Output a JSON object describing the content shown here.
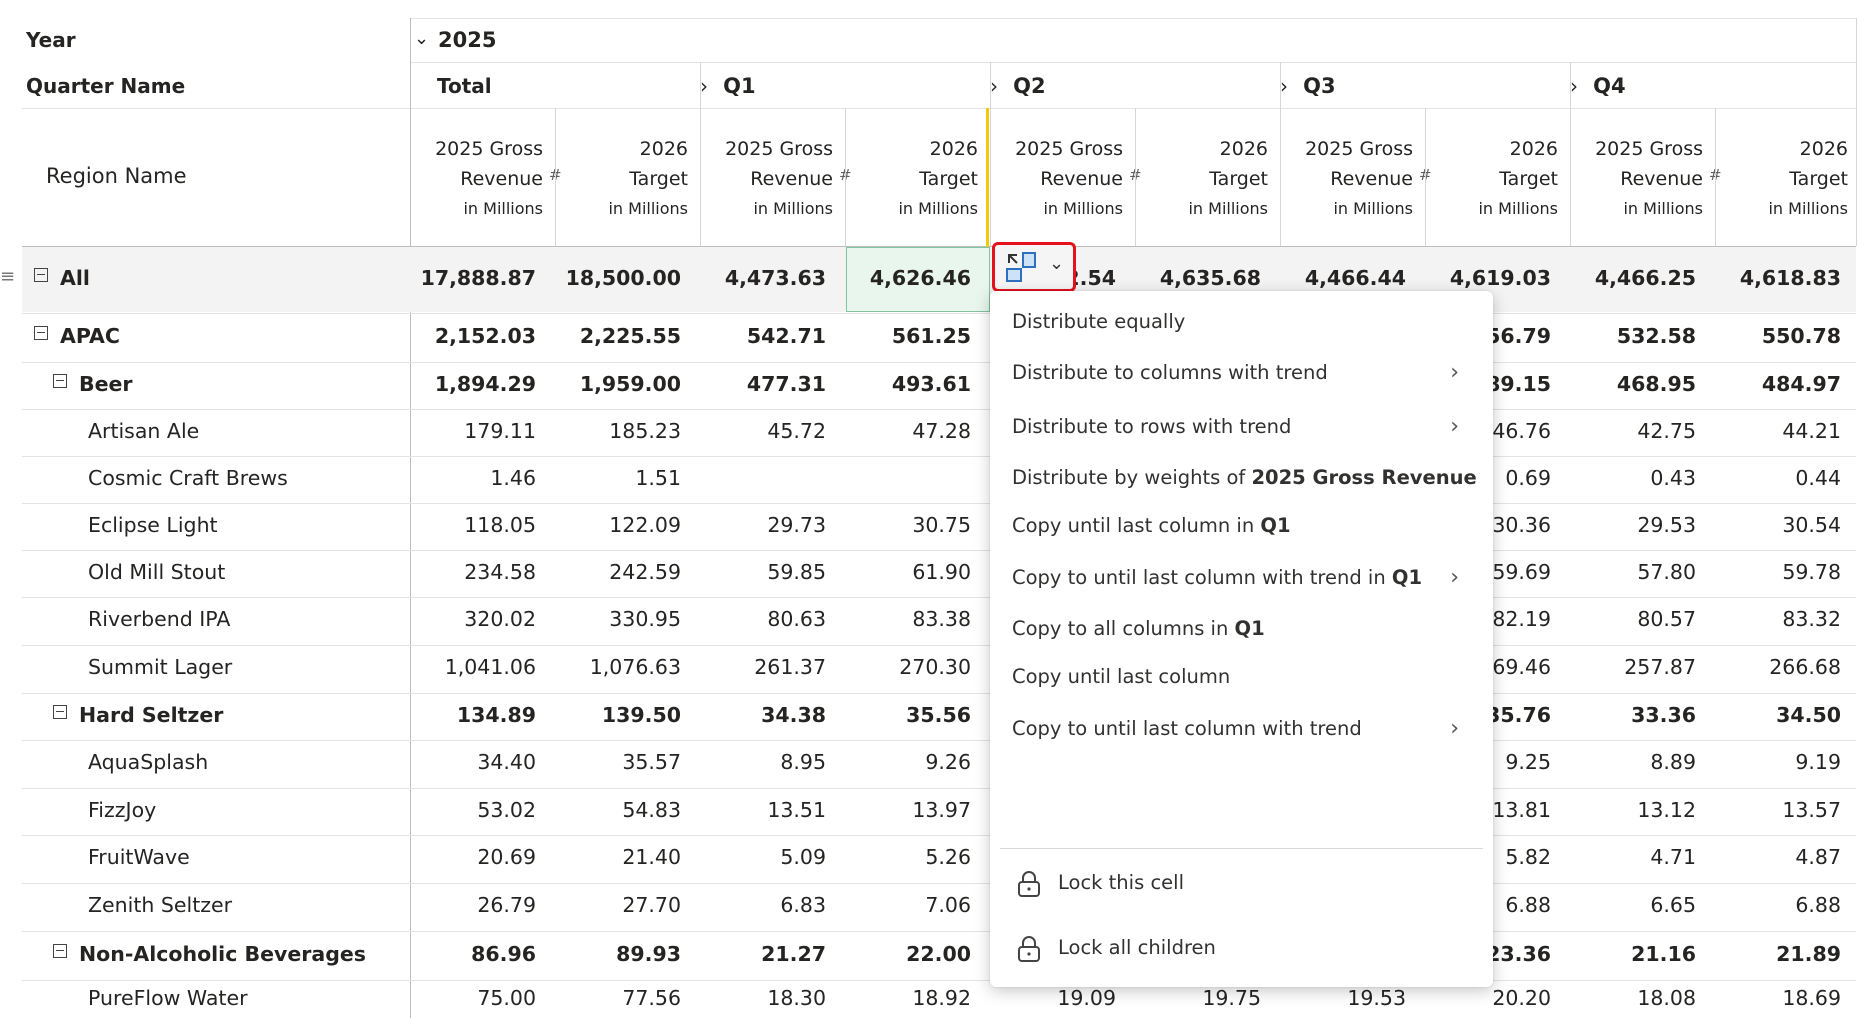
{
  "header": {
    "year_label": "Year",
    "year_value": "2025",
    "quarter_label": "Quarter Name",
    "region_label": "Region Name",
    "total_label": "Total",
    "quarters": [
      "Q1",
      "Q2",
      "Q3",
      "Q4"
    ],
    "col_gross_line1": "2025 Gross",
    "col_gross_line2": "Revenue",
    "col_target_line1": "2026",
    "col_target_line2": "Target",
    "col_unit": "in Millions",
    "hash": "#"
  },
  "rows": [
    {
      "name": "All",
      "level": 0,
      "bold": true,
      "expander": true,
      "values": [
        "17,888.87",
        "18,500.00",
        "4,473.63",
        "4,626.46",
        "2.54",
        "4,635.68",
        "4,466.44",
        "4,619.03",
        "4,466.25",
        "4,618.83"
      ]
    },
    {
      "name": "APAC",
      "level": 0,
      "bold": true,
      "expander": true,
      "values": [
        "2,152.03",
        "2,225.55",
        "542.71",
        "561.25",
        "",
        "",
        "",
        "56.79",
        "532.58",
        "550.78"
      ]
    },
    {
      "name": "Beer",
      "level": 1,
      "bold": true,
      "expander": true,
      "values": [
        "1,894.29",
        "1,959.00",
        "477.31",
        "493.61",
        "",
        "",
        "",
        "89.15",
        "468.95",
        "484.97"
      ]
    },
    {
      "name": "Artisan Ale",
      "level": 2,
      "bold": false,
      "expander": false,
      "values": [
        "179.11",
        "185.23",
        "45.72",
        "47.28",
        "",
        "",
        "",
        "46.76",
        "42.75",
        "44.21"
      ]
    },
    {
      "name": "Cosmic Craft Brews",
      "level": 2,
      "bold": false,
      "expander": false,
      "values": [
        "1.46",
        "1.51",
        "",
        "",
        "",
        "",
        "",
        "0.69",
        "0.43",
        "0.44"
      ]
    },
    {
      "name": "Eclipse Light",
      "level": 2,
      "bold": false,
      "expander": false,
      "values": [
        "118.05",
        "122.09",
        "29.73",
        "30.75",
        "",
        "",
        "",
        "30.36",
        "29.53",
        "30.54"
      ]
    },
    {
      "name": "Old Mill Stout",
      "level": 2,
      "bold": false,
      "expander": false,
      "values": [
        "234.58",
        "242.59",
        "59.85",
        "61.90",
        "",
        "",
        "",
        "59.69",
        "57.80",
        "59.78"
      ]
    },
    {
      "name": "Riverbend IPA",
      "level": 2,
      "bold": false,
      "expander": false,
      "values": [
        "320.02",
        "330.95",
        "80.63",
        "83.38",
        "",
        "",
        "",
        "82.19",
        "80.57",
        "83.32"
      ]
    },
    {
      "name": "Summit Lager",
      "level": 2,
      "bold": false,
      "expander": false,
      "values": [
        "1,041.06",
        "1,076.63",
        "261.37",
        "270.30",
        "",
        "",
        "",
        "69.46",
        "257.87",
        "266.68"
      ]
    },
    {
      "name": "Hard Seltzer",
      "level": 1,
      "bold": true,
      "expander": true,
      "values": [
        "134.89",
        "139.50",
        "34.38",
        "35.56",
        "",
        "",
        "",
        "35.76",
        "33.36",
        "34.50"
      ]
    },
    {
      "name": "AquaSplash",
      "level": 2,
      "bold": false,
      "expander": false,
      "values": [
        "34.40",
        "35.57",
        "8.95",
        "9.26",
        "",
        "",
        "",
        "9.25",
        "8.89",
        "9.19"
      ]
    },
    {
      "name": "FizzJoy",
      "level": 2,
      "bold": false,
      "expander": false,
      "values": [
        "53.02",
        "54.83",
        "13.51",
        "13.97",
        "",
        "",
        "",
        "13.81",
        "13.12",
        "13.57"
      ]
    },
    {
      "name": "FruitWave",
      "level": 2,
      "bold": false,
      "expander": false,
      "values": [
        "20.69",
        "21.40",
        "5.09",
        "5.26",
        "",
        "",
        "",
        "5.82",
        "4.71",
        "4.87"
      ]
    },
    {
      "name": "Zenith Seltzer",
      "level": 2,
      "bold": false,
      "expander": false,
      "values": [
        "26.79",
        "27.70",
        "6.83",
        "7.06",
        "",
        "",
        "",
        "6.88",
        "6.65",
        "6.88"
      ]
    },
    {
      "name": "Non-Alcoholic Beverages",
      "level": 1,
      "bold": true,
      "expander": true,
      "values": [
        "86.96",
        "89.93",
        "21.27",
        "22.00",
        "",
        "",
        "",
        "23.36",
        "21.16",
        "21.89"
      ]
    },
    {
      "name": "PureFlow Water",
      "level": 2,
      "bold": false,
      "expander": false,
      "values": [
        "75.00",
        "77.56",
        "18.30",
        "18.92",
        "19.09",
        "19.75",
        "19.53",
        "20.20",
        "18.08",
        "18.69"
      ]
    }
  ],
  "menu": {
    "items": [
      {
        "text": "Distribute equally",
        "bold": "",
        "submenu": false
      },
      {
        "text": "Distribute to columns with trend",
        "bold": "",
        "submenu": true
      },
      {
        "text": "Distribute to rows with trend",
        "bold": "",
        "submenu": true
      },
      {
        "text": "Distribute by weights of ",
        "bold": "2025 Gross Revenue",
        "submenu": false
      },
      {
        "text": "Copy until last column in ",
        "bold": "Q1",
        "submenu": false
      },
      {
        "text": "Copy to until last column with trend in ",
        "bold": "Q1",
        "submenu": true
      },
      {
        "text": "Copy to all columns in ",
        "bold": "Q1",
        "submenu": false
      },
      {
        "text": "Copy until last column",
        "bold": "",
        "submenu": false
      },
      {
        "text": "Copy to until last column with trend",
        "bold": "",
        "submenu": true
      }
    ],
    "lock_items": [
      "Lock this cell",
      "Lock all children"
    ]
  },
  "colors": {
    "selected_cell_bg": "#e8f6ee",
    "trigger_border": "#e3121c",
    "accent_line": "#f2c811"
  },
  "icons": {
    "expander": "minus-box-icon",
    "menu_trigger": "distribute-icon",
    "chevron": "chevron-right-icon",
    "lock": "lock-icon"
  }
}
